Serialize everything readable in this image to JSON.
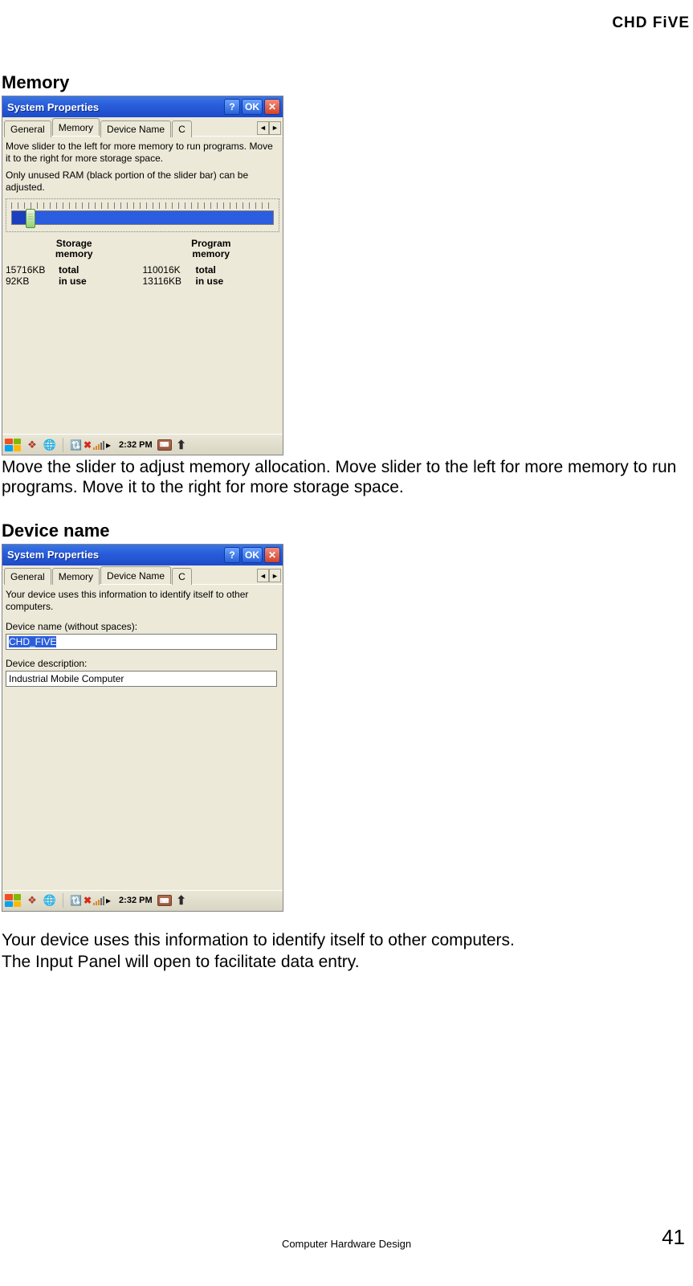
{
  "brand": "CHD FiVE",
  "section1_heading": "Memory",
  "section1_para": "Move the slider to adjust memory allocation. Move slider to the left for more memory to run programs. Move it to the right for more storage space.",
  "section2_heading": "Device name",
  "section2_para1": "Your device uses this information to identify itself to other computers.",
  "section2_para2": "The Input Panel will open to facilitate data entry.",
  "footer_text": "Computer Hardware Design",
  "page_number": "41",
  "window": {
    "title": "System Properties",
    "help_btn": "?",
    "ok_btn": "OK",
    "close_btn": "✕",
    "tabs": {
      "general": "General",
      "memory": "Memory",
      "device_name": "Device Name",
      "copyrights_partial": "C"
    },
    "tab_left": "◄",
    "tab_right": "►"
  },
  "memory_panel": {
    "info1": "Move slider to the left for more memory to run programs. Move it to the right for more storage space.",
    "info2": "Only unused RAM (black portion of the slider bar) can be adjusted.",
    "storage_hdr": "Storage memory",
    "program_hdr": "Program memory",
    "storage_total_val": "15716KB",
    "storage_total_lbl": "total",
    "storage_inuse_val": "92KB",
    "storage_inuse_lbl": "in use",
    "program_total_val": "110016K",
    "program_total_lbl": "total",
    "program_inuse_val": "13116KB",
    "program_inuse_lbl": "in use"
  },
  "devicename_panel": {
    "info": "Your device uses this information to identify itself to other computers.",
    "name_label": "Device name (without spaces):",
    "name_value": "CHD_FIVE",
    "desc_label": "Device description:",
    "desc_value": "Industrial Mobile Computer"
  },
  "taskbar": {
    "time": "2:32 PM"
  }
}
